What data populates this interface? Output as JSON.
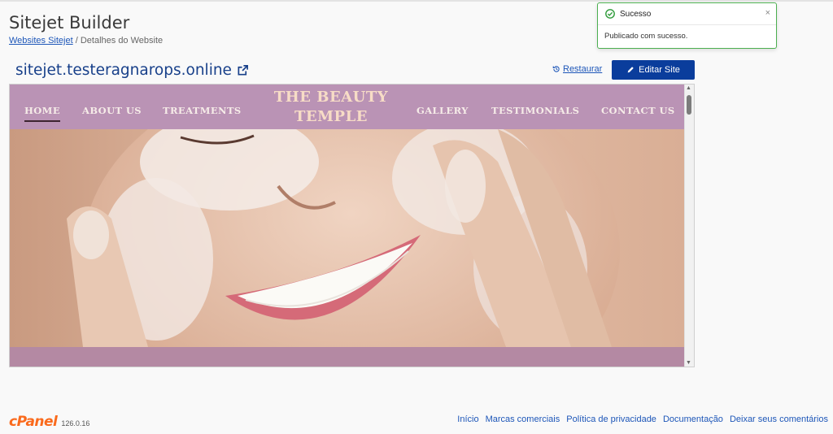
{
  "header": {
    "title": "Sitejet Builder",
    "breadcrumb": {
      "link": "Websites Sitejet",
      "separator": " / ",
      "current": "Detalhes do Website"
    }
  },
  "site": {
    "url": "sitejet.testeragnarops.online",
    "restore_label": "Restaurar",
    "edit_label": "Editar Site"
  },
  "preview": {
    "brand": [
      "THE BEAUTY",
      "TEMPLE"
    ],
    "nav": [
      "HOME",
      "ABOUT US",
      "TREATMENTS",
      "GALLERY",
      "TESTIMONIALS",
      "CONTACT US"
    ],
    "active_nav": "HOME",
    "nav_color": "#ba93b5"
  },
  "toast": {
    "title": "Sucesso",
    "message": "Publicado com sucesso.",
    "close": "×",
    "status_color": "#4caf50"
  },
  "footer": {
    "logo": "cPanel",
    "version": "126.0.16",
    "links": [
      "Início",
      "Marcas comerciais",
      "Política de privacidade",
      "Documentação",
      "Deixar seus comentários"
    ]
  },
  "colors": {
    "accent": "#0a3d9c",
    "link": "#1d56b8",
    "cpanel": "#fa6a1c"
  }
}
